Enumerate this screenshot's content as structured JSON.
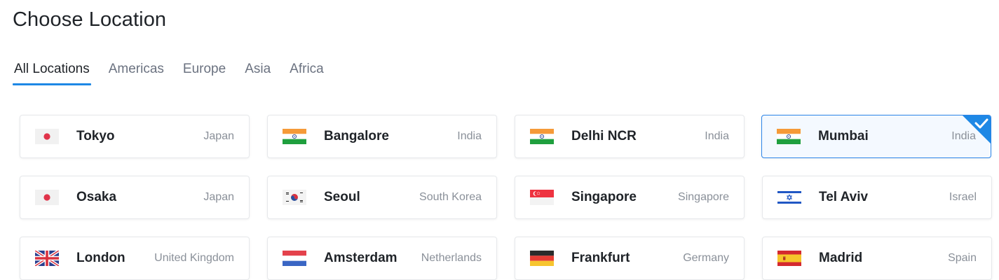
{
  "page": {
    "title": "Choose Location"
  },
  "tabs": [
    {
      "label": "All Locations",
      "active": true
    },
    {
      "label": "Americas",
      "active": false
    },
    {
      "label": "Europe",
      "active": false
    },
    {
      "label": "Asia",
      "active": false
    },
    {
      "label": "Africa",
      "active": false
    }
  ],
  "locations": [
    {
      "city": "Tokyo",
      "country": "Japan",
      "flag": "japan-flag-icon",
      "selected": false
    },
    {
      "city": "Bangalore",
      "country": "India",
      "flag": "india-flag-icon",
      "selected": false
    },
    {
      "city": "Delhi NCR",
      "country": "India",
      "flag": "india-flag-icon",
      "selected": false
    },
    {
      "city": "Mumbai",
      "country": "India",
      "flag": "india-flag-icon",
      "selected": true
    },
    {
      "city": "Osaka",
      "country": "Japan",
      "flag": "japan-flag-icon",
      "selected": false
    },
    {
      "city": "Seoul",
      "country": "South Korea",
      "flag": "south-korea-flag-icon",
      "selected": false
    },
    {
      "city": "Singapore",
      "country": "Singapore",
      "flag": "singapore-flag-icon",
      "selected": false
    },
    {
      "city": "Tel Aviv",
      "country": "Israel",
      "flag": "israel-flag-icon",
      "selected": false
    },
    {
      "city": "London",
      "country": "United Kingdom",
      "flag": "uk-flag-icon",
      "selected": false
    },
    {
      "city": "Amsterdam",
      "country": "Netherlands",
      "flag": "netherlands-flag-icon",
      "selected": false
    },
    {
      "city": "Frankfurt",
      "country": "Germany",
      "flag": "germany-flag-icon",
      "selected": false
    },
    {
      "city": "Madrid",
      "country": "Spain",
      "flag": "spain-flag-icon",
      "selected": false
    }
  ],
  "colors": {
    "accent": "#1e88e5",
    "selected_border": "#2b84e8",
    "selected_bg": "#f4f9ff"
  },
  "selected_icon": "checkmark-icon"
}
